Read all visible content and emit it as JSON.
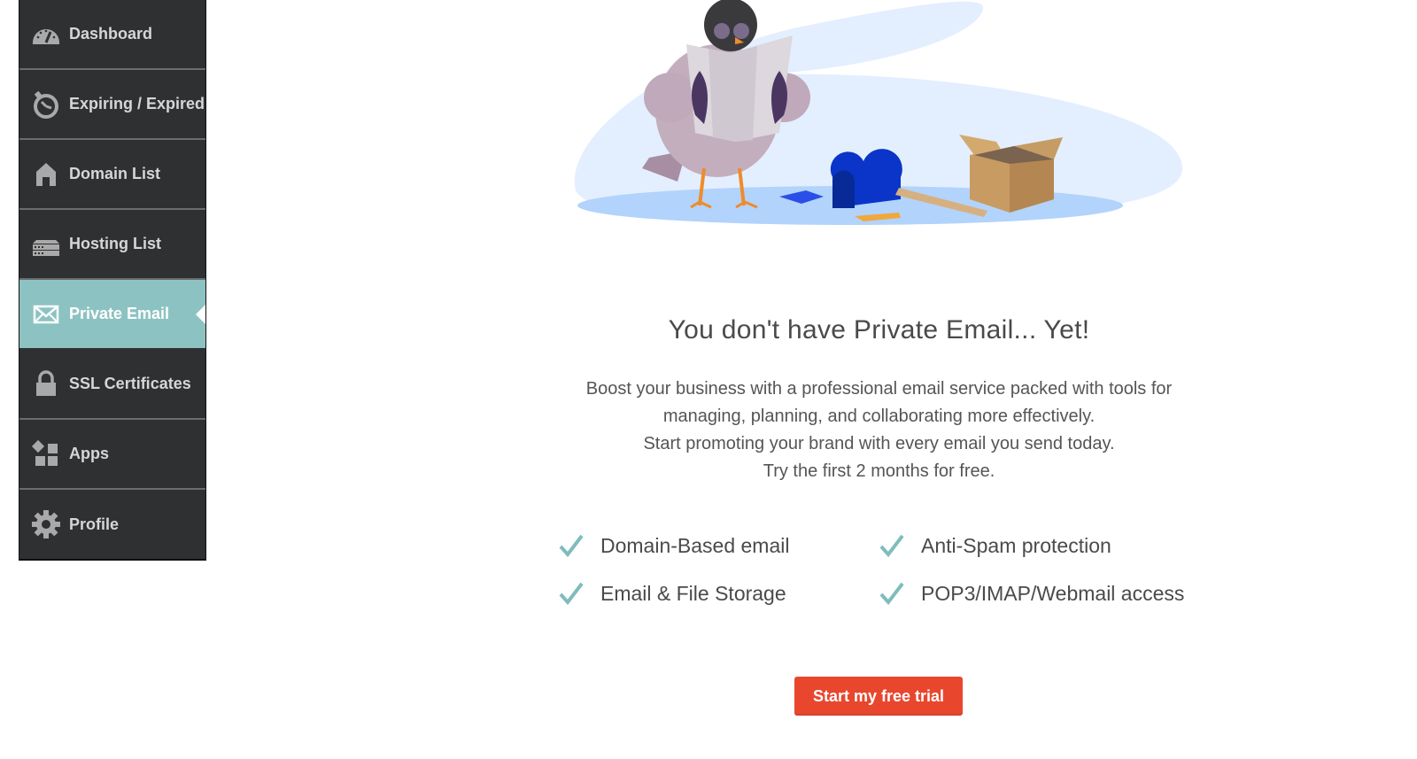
{
  "sidebar": {
    "items": [
      {
        "label": "Dashboard",
        "icon": "speedometer-icon",
        "active": false
      },
      {
        "label": "Expiring / Expired",
        "icon": "stopwatch-icon",
        "active": false
      },
      {
        "label": "Domain List",
        "icon": "house-icon",
        "active": false
      },
      {
        "label": "Hosting List",
        "icon": "server-icon",
        "active": false
      },
      {
        "label": "Private Email",
        "icon": "envelope-icon",
        "active": true
      },
      {
        "label": "SSL Certificates",
        "icon": "lock-icon",
        "active": false
      },
      {
        "label": "Apps",
        "icon": "apps-grid-icon",
        "active": false
      },
      {
        "label": "Profile",
        "icon": "gear-icon",
        "active": false
      }
    ]
  },
  "main": {
    "illustration": "pigeon-reading-map-with-broken-mailbox-illustration",
    "title": "You don't have Private Email... Yet!",
    "description": [
      "Boost your business with a professional email service packed with tools for",
      "managing, planning, and collaborating more effectively.",
      "Start promoting your brand with every email you send today.",
      "Try the first 2 months for free."
    ],
    "features": [
      "Domain-Based email",
      "Anti-Spam protection",
      "Email & File Storage",
      "POP3/IMAP/Webmail access"
    ],
    "cta_label": "Start my free trial"
  },
  "colors": {
    "sidebar_bg": "#2f3032",
    "sidebar_active": "#8cc3c2",
    "check": "#7fbcbc",
    "cta": "#e8472e"
  }
}
